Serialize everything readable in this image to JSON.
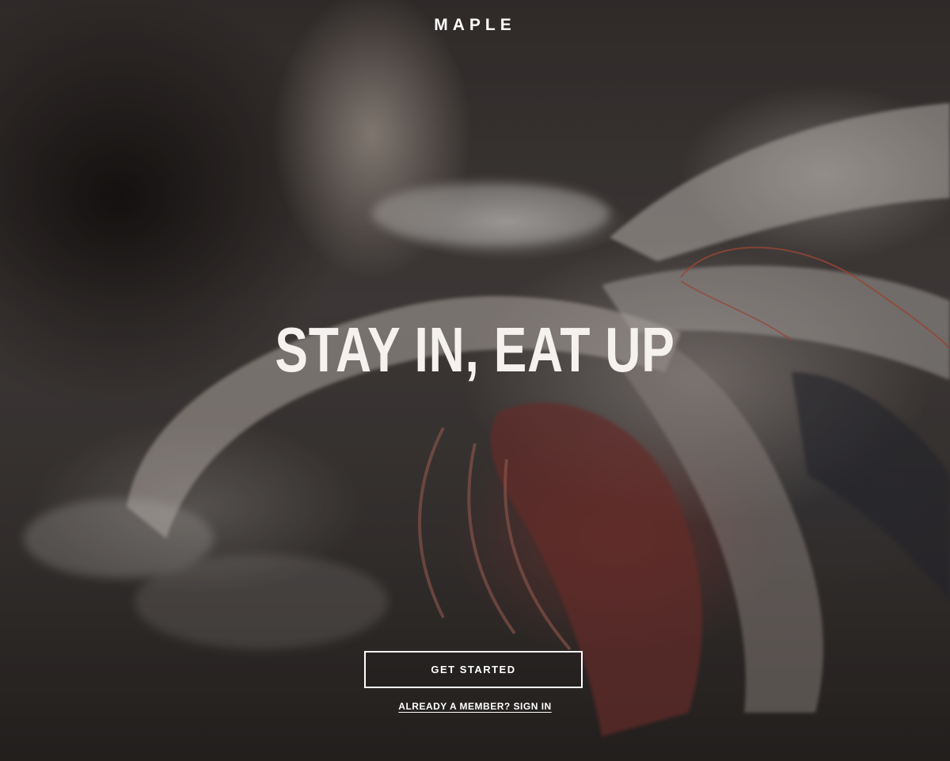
{
  "brand": {
    "logo_text": "MAPLE"
  },
  "hero": {
    "headline": "STAY IN, EAT UP",
    "background_description_icon": "cooking-shrimp-background-image"
  },
  "actions": {
    "get_started_label": "GET STARTED",
    "sign_in_label": "ALREADY A MEMBER? SIGN IN"
  },
  "colors": {
    "text": "#ffffff",
    "button_border": "#ffffff"
  }
}
